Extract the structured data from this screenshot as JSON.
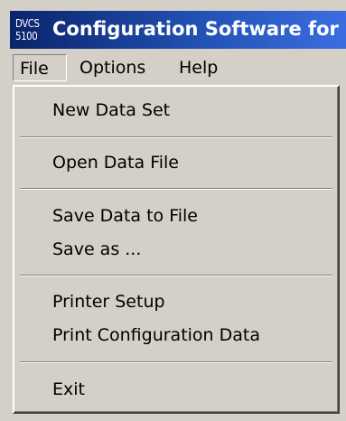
{
  "app": {
    "logo_line1": "DVCS",
    "logo_line2": "5100",
    "title": "Configuration Software for"
  },
  "menubar": {
    "items": [
      {
        "label": "File"
      },
      {
        "label": "Options"
      },
      {
        "label": "Help"
      }
    ]
  },
  "file_menu": {
    "items": [
      {
        "label": "New Data Set"
      },
      {
        "label": "Open Data File"
      },
      {
        "label": "Save Data  to File"
      },
      {
        "label": "Save as ..."
      },
      {
        "label": "Printer Setup"
      },
      {
        "label": "Print Configuration Data"
      },
      {
        "label": "Exit"
      }
    ]
  },
  "colors": {
    "titlebar_start": "#0a246a",
    "titlebar_end": "#3a6ee0",
    "menu_background": "#d4d0c8"
  }
}
